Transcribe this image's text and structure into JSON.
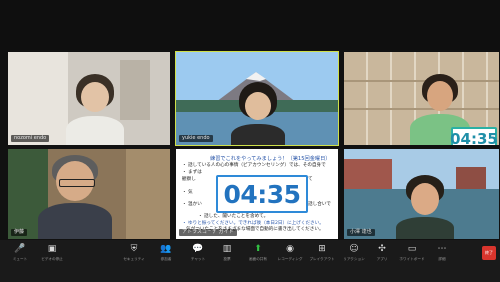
{
  "meeting": {
    "participants": [
      {
        "name": "nozomi endo"
      },
      {
        "name": "yukie endo"
      },
      {
        "name": ""
      },
      {
        "name": "伊藤"
      },
      {
        "name": "アトラスコーチ ガイド"
      },
      {
        "name": "小澤 達也"
      }
    ],
    "active_speaker_index": 1
  },
  "slide": {
    "title": "練習でこれをやってみましょう！（第15回金曜日）",
    "lines": [
      "・ 話している人の心の事情（ピアカウンセリング）では、その自身で",
      "・ まずは",
      "  観察し",
      "  て",
      "・ 気",
      "・ 温かい",
      "  話し合いで",
      "・ 話した、聞いたことを含めて。",
      "・ ゆりと振ってください。できれば後（本日2日）に上げください。",
      "  気がついたことをさまざまな場面で自動的に書き出してください。"
    ]
  },
  "timers": {
    "main": "04:35",
    "thumb": "04:35"
  },
  "toolbar": {
    "items": [
      {
        "icon": "microphone-icon",
        "glyph": "🎤",
        "label": "ミュート"
      },
      {
        "icon": "video-icon",
        "glyph": "▣",
        "label": "ビデオの停止"
      },
      {
        "icon": "security-icon",
        "glyph": "⛨",
        "label": "セキュリティ"
      },
      {
        "icon": "participants-icon",
        "glyph": "👥",
        "label": "参加者"
      },
      {
        "icon": "chat-icon",
        "glyph": "💬",
        "label": "チャット"
      },
      {
        "icon": "polls-icon",
        "glyph": "▥",
        "label": "投票"
      },
      {
        "icon": "share-screen-icon",
        "glyph": "⬆",
        "label": "画面の共有"
      },
      {
        "icon": "record-icon",
        "glyph": "◉",
        "label": "レコーディング"
      },
      {
        "icon": "breakout-rooms-icon",
        "glyph": "⊞",
        "label": "ブレイクアウト"
      },
      {
        "icon": "reactions-icon",
        "glyph": "☺",
        "label": "リアクション"
      },
      {
        "icon": "apps-icon",
        "glyph": "✣",
        "label": "アプリ"
      },
      {
        "icon": "whiteboard-icon",
        "glyph": "▭",
        "label": "ホワイトボード"
      },
      {
        "icon": "more-icon",
        "glyph": "⋯",
        "label": "詳細"
      }
    ],
    "end_label": "終了"
  },
  "colors": {
    "accent_green": "#33c244",
    "active_border": "#cfe04a",
    "timer_blue": "#2273bf",
    "end_red": "#d9352d"
  }
}
